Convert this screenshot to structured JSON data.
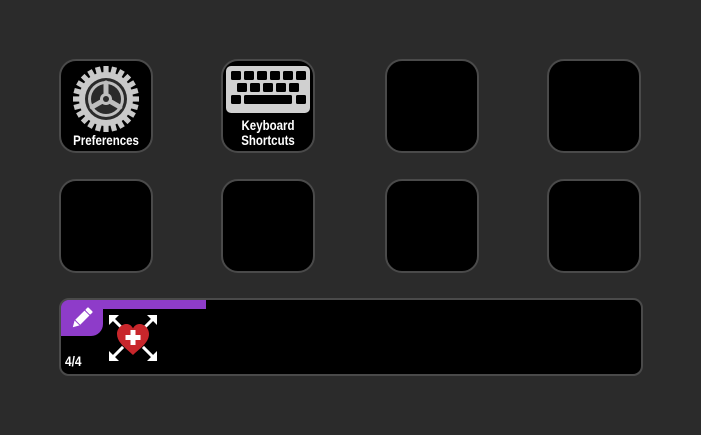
{
  "keys": [
    {
      "label": "Preferences",
      "icon": "gear-icon"
    },
    {
      "label": "Keyboard\nShortcuts",
      "icon": "keyboard-icon"
    },
    {
      "label": "",
      "icon": ""
    },
    {
      "label": "",
      "icon": ""
    },
    {
      "label": "",
      "icon": ""
    },
    {
      "label": "",
      "icon": ""
    },
    {
      "label": "",
      "icon": ""
    },
    {
      "label": "",
      "icon": ""
    }
  ],
  "dial_strip": {
    "page_indicator": "4/4",
    "progress_fraction": 0.25,
    "edit_icon": "pencil-icon",
    "action_icon": "heart-expand-icon",
    "accent_color": "#8e3cc9"
  },
  "colors": {
    "background": "#2b2b2b",
    "key_border": "#4a4a4a",
    "key_fill": "#000000",
    "heart": "#c8262b"
  }
}
